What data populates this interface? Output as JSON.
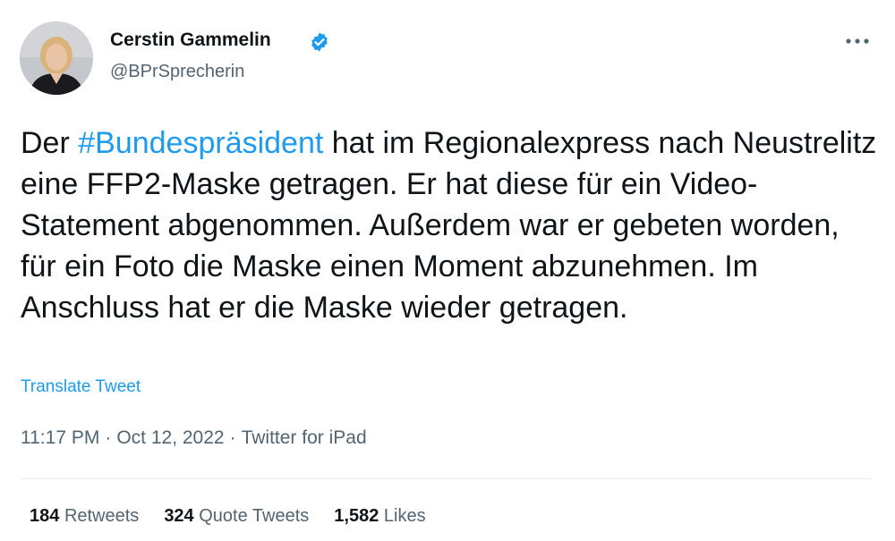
{
  "author": {
    "name": "Cerstin Gammelin",
    "handle": "@BPrSprecherin",
    "verified_icon": "verified-badge-icon",
    "avatar_icon": "avatar"
  },
  "menu": {
    "more_icon": "more-options-icon"
  },
  "tweet": {
    "text_before": "Der ",
    "hashtag": "#Bundespräsident",
    "text_after": " hat im Regionalexpress nach Neustrelitz eine FFP2-Maske getragen. Er hat diese für ein Video-Statement abgenommen. Außerdem war er gebeten worden, für ein Foto die Maske einen Moment abzunehmen. Im Anschluss hat er die Maske wieder getragen.",
    "translate_label": "Translate Tweet"
  },
  "meta": {
    "time": "11:17 PM",
    "separator": "·",
    "date": "Oct 12, 2022",
    "source": "Twitter for iPad"
  },
  "stats": {
    "retweets_count": "184",
    "retweets_label": "Retweets",
    "quotes_count": "324",
    "quotes_label": "Quote Tweets",
    "likes_count": "1,582",
    "likes_label": "Likes"
  },
  "colors": {
    "accent": "#1d9bf0",
    "text": "#0f1419",
    "secondary": "#536471",
    "divider": "#e7e9ea"
  }
}
